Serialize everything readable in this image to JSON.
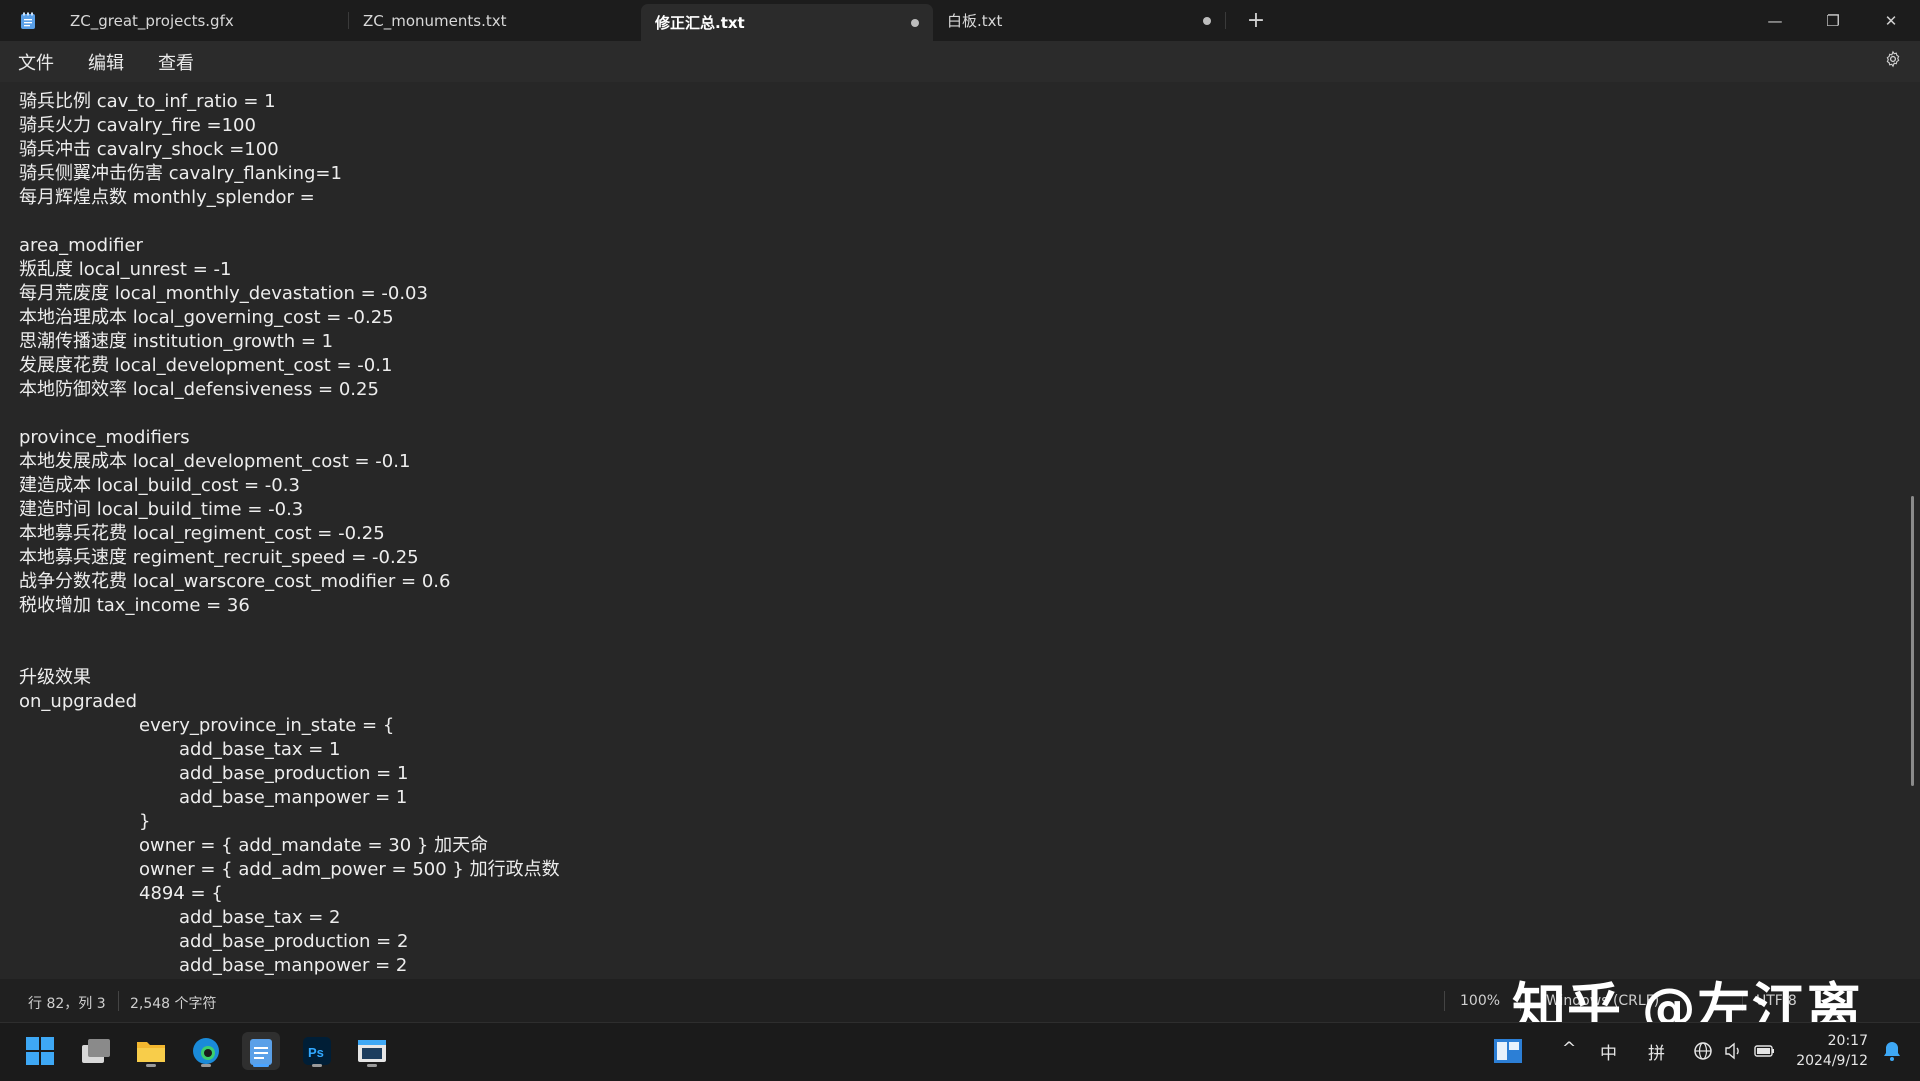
{
  "tabs": [
    {
      "label": "ZC_great_projects.gfx",
      "modified": false,
      "active": false
    },
    {
      "label": "ZC_monuments.txt",
      "modified": false,
      "active": false
    },
    {
      "label": "修正汇总.txt",
      "modified": true,
      "active": true
    },
    {
      "label": "白板.txt",
      "modified": true,
      "active": false
    }
  ],
  "window_controls": {
    "minimize": "—",
    "maximize": "❐",
    "close": "✕"
  },
  "new_tab": "+",
  "menu": {
    "file": "文件",
    "edit": "编辑",
    "view": "查看"
  },
  "editor": {
    "lines": [
      "骑兵比例 cav_to_inf_ratio = 1",
      "骑兵火力 cavalry_fire =100",
      "骑兵冲击 cavalry_shock =100",
      "骑兵侧翼冲击伤害 cavalry_flanking=1",
      "每月辉煌点数 monthly_splendor =",
      "",
      "area_modifier",
      "叛乱度 local_unrest = -1",
      "每月荒废度 local_monthly_devastation = -0.03",
      "本地治理成本 local_governing_cost = -0.25",
      "思潮传播速度 institution_growth = 1",
      "发展度花费 local_development_cost = -0.1",
      "本地防御效率 local_defensiveness = 0.25",
      "",
      "province_modifiers",
      "本地发展成本 local_development_cost = -0.1",
      "建造成本 local_build_cost = -0.3",
      "建造时间 local_build_time = -0.3",
      "本地募兵花费 local_regiment_cost = -0.25",
      "本地募兵速度 regiment_recruit_speed = -0.25",
      "战争分数花费 local_warscore_cost_modifier = 0.6",
      "税收增加 tax_income = 36",
      "",
      "",
      "升级效果",
      "on_upgraded",
      "\t\tevery_province_in_state = {",
      "\t\t\tadd_base_tax = 1",
      "\t\t\tadd_base_production = 1",
      "\t\t\tadd_base_manpower = 1",
      "\t\t}",
      "\t\towner = { add_mandate = 30 } 加天命",
      "\t\towner = { add_adm_power = 500 } 加行政点数",
      "\t\t4894 = {",
      "\t\t\tadd_base_tax = 2",
      "\t\t\tadd_base_production = 2",
      "\t\t\tadd_base_manpower = 2"
    ]
  },
  "status": {
    "position": "行 82，列 3",
    "char_count": "2,548 个字符",
    "zoom": "100%",
    "line_ending": "Windows (CRLF)",
    "encoding": "UTF-8"
  },
  "watermark": "知乎 @左江离",
  "taskbar": {
    "apps": [
      "start-icon",
      "task-view-icon",
      "file-explorer-icon",
      "edge-icon",
      "notepad-icon",
      "photoshop-icon",
      "window-app-icon"
    ],
    "tray": {
      "chevron": "^",
      "ime_lang": "中",
      "ime_mode": "拼"
    },
    "time": "20:17",
    "date": "2024/9/12"
  },
  "colors": {
    "background": "#272727",
    "titlebar": "#1c1c1c",
    "text": "#ededed",
    "accent": "#4aa3ff"
  }
}
